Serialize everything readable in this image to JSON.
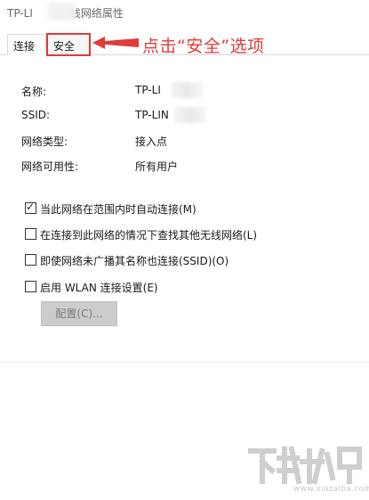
{
  "window": {
    "title_prefix": "TP-LI",
    "title_suffix": "无线网络属性"
  },
  "tabs": [
    {
      "label": "连接",
      "active": true
    },
    {
      "label": "安全",
      "active": false,
      "highlighted": true
    }
  ],
  "annotation": {
    "text": "点击“安全”选项",
    "color": "#e03a3a"
  },
  "properties": [
    {
      "label": "名称:",
      "value": "TP-LI"
    },
    {
      "label": "SSID:",
      "value": "TP-LIN"
    },
    {
      "label": "网络类型:",
      "value": "接入点"
    },
    {
      "label": "网络可用性:",
      "value": "所有用户"
    }
  ],
  "options": [
    {
      "label": "当此网络在范围内时自动连接(M)",
      "checked": true
    },
    {
      "label": "在连接到此网络的情况下查找其他无线网络(L)",
      "checked": false
    },
    {
      "label": "即使网络未广播其名称也连接(SSID)(O)",
      "checked": false
    },
    {
      "label": "启用 WLAN 连接设置(E)",
      "checked": false
    }
  ],
  "config_button": {
    "label": "配置(C)..."
  },
  "watermark": {
    "url": "www.xiazaiba.com"
  }
}
